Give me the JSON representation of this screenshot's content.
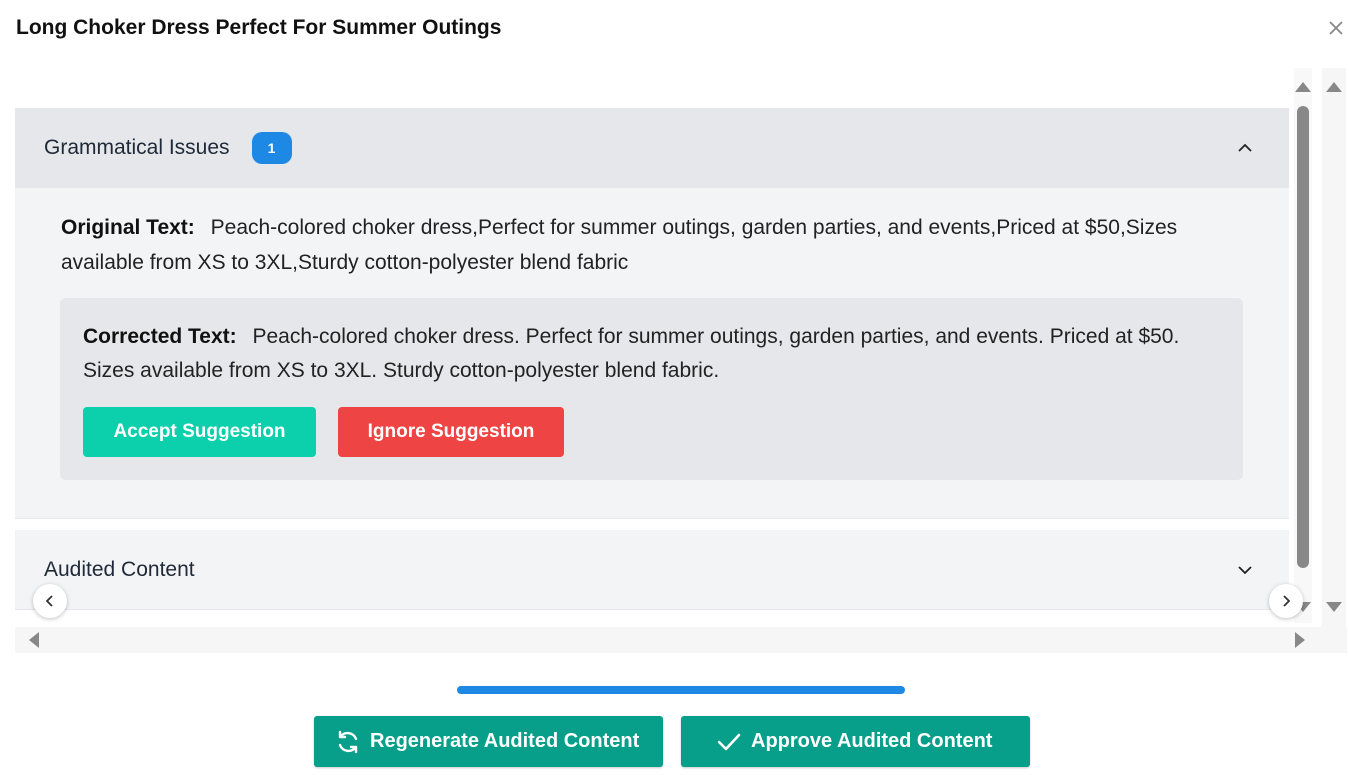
{
  "modal": {
    "title": "Long Choker Dress Perfect For Summer Outings",
    "close_icon": "close-icon"
  },
  "grammar_section": {
    "label": "Grammatical Issues",
    "count": "1",
    "original_label": "Original Text:",
    "original_text": "Peach-colored choker dress,Perfect for summer outings, garden parties, and events,Priced at $50,Sizes available from XS to 3XL,Sturdy cotton-polyester blend fabric",
    "corrected_label": "Corrected Text:",
    "corrected_text": "Peach-colored choker dress. Perfect for summer outings, garden parties, and events. Priced at $50. Sizes available from XS to 3XL. Sturdy cotton-polyester blend fabric.",
    "accept_label": "Accept Suggestion",
    "ignore_label": "Ignore Suggestion"
  },
  "audited_section": {
    "label": "Audited Content"
  },
  "actions": {
    "regenerate_label": "Regenerate Audited Content",
    "approve_label": "Approve Audited Content"
  },
  "colors": {
    "badge": "#1e88e5",
    "accept": "#0bd0ab",
    "ignore": "#ef4444",
    "action_buttons": "#079f8a",
    "progress": "#1e88e5"
  }
}
